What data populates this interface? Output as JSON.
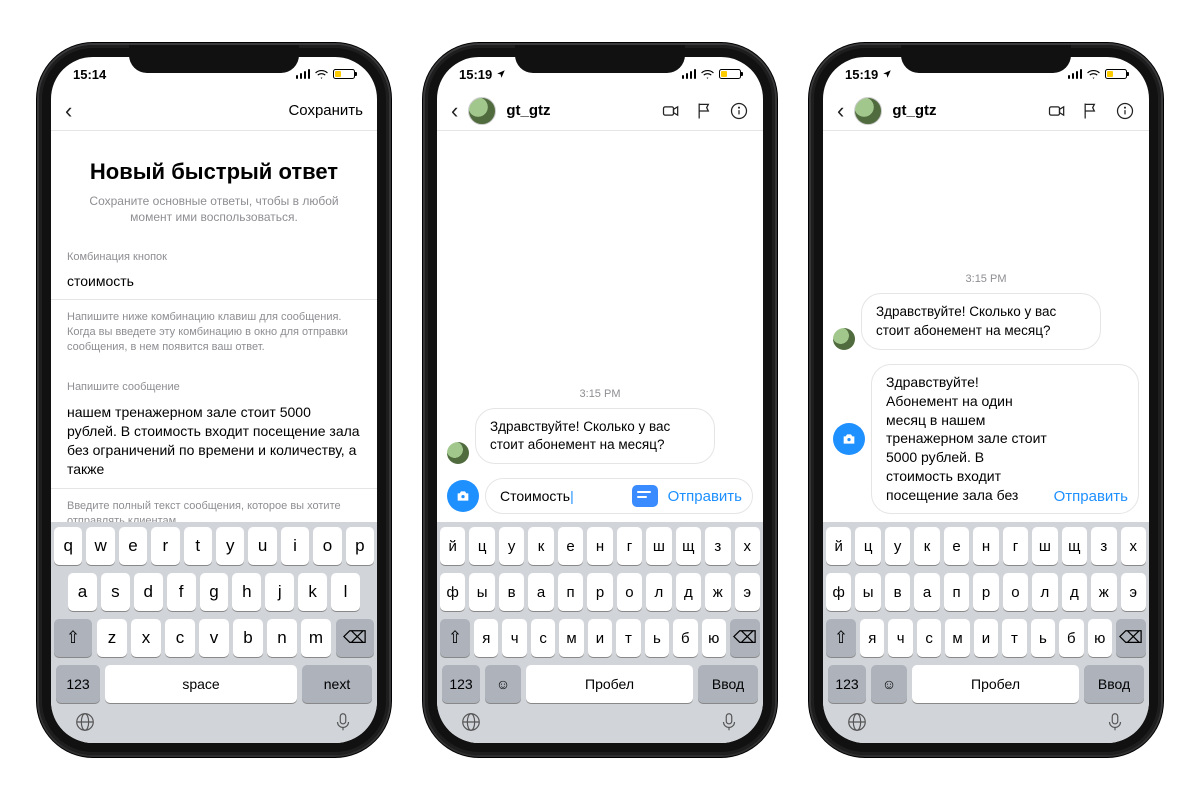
{
  "phone1": {
    "time": "15:14",
    "save": "Сохранить",
    "title": "Новый быстрый ответ",
    "subtitle": "Сохраните основные ответы, чтобы в любой момент ими воспользоваться.",
    "shortcut_label": "Комбинация кнопок",
    "shortcut_value": "стоимость",
    "shortcut_help": "Напишите ниже комбинацию клавиш для сообщения. Когда вы введете эту комбинацию в окно для отправки сообщения, в нем появится ваш ответ.",
    "message_label": "Напишите сообщение",
    "message_value": "нашем тренажерном зале стоит 5000 рублей. В стоимость входит посещение зала без ограничений по времени и количеству, а также",
    "message_help": "Введите полный текст сообщения, которое вы хотите отправлять клиентам.",
    "kb": {
      "row1": [
        "q",
        "w",
        "e",
        "r",
        "t",
        "y",
        "u",
        "i",
        "o",
        "p"
      ],
      "row2": [
        "a",
        "s",
        "d",
        "f",
        "g",
        "h",
        "j",
        "k",
        "l"
      ],
      "row3": [
        "z",
        "x",
        "c",
        "v",
        "b",
        "n",
        "m"
      ],
      "k123": "123",
      "space": "space",
      "next": "next"
    }
  },
  "phone2": {
    "time": "15:19",
    "username": "gt_gtz",
    "timestamp": "3:15 PM",
    "incoming": "Здравствуйте! Сколько у вас стоит абонемент на месяц?",
    "compose_text": "Стоимость",
    "send": "Отправить",
    "kb": {
      "row1": [
        "й",
        "ц",
        "у",
        "к",
        "е",
        "н",
        "г",
        "ш",
        "щ",
        "з",
        "х"
      ],
      "row2": [
        "ф",
        "ы",
        "в",
        "а",
        "п",
        "р",
        "о",
        "л",
        "д",
        "ж",
        "э"
      ],
      "row3": [
        "я",
        "ч",
        "с",
        "м",
        "и",
        "т",
        "ь",
        "б",
        "ю"
      ],
      "k123": "123",
      "space": "Пробел",
      "next": "Ввод"
    }
  },
  "phone3": {
    "time": "15:19",
    "username": "gt_gtz",
    "timestamp": "3:15 PM",
    "incoming": "Здравствуйте! Сколько у вас стоит абонемент на месяц?",
    "compose_text": "Здравствуйте! Абонемент на один месяц в нашем тренажерном зале стоит 5000 рублей. В стоимость входит посещение зала без",
    "send": "Отправить",
    "kb": {
      "row1": [
        "й",
        "ц",
        "у",
        "к",
        "е",
        "н",
        "г",
        "ш",
        "щ",
        "з",
        "х"
      ],
      "row2": [
        "ф",
        "ы",
        "в",
        "а",
        "п",
        "р",
        "о",
        "л",
        "д",
        "ж",
        "э"
      ],
      "row3": [
        "я",
        "ч",
        "с",
        "м",
        "и",
        "т",
        "ь",
        "б",
        "ю"
      ],
      "k123": "123",
      "space": "Пробел",
      "next": "Ввод"
    }
  }
}
